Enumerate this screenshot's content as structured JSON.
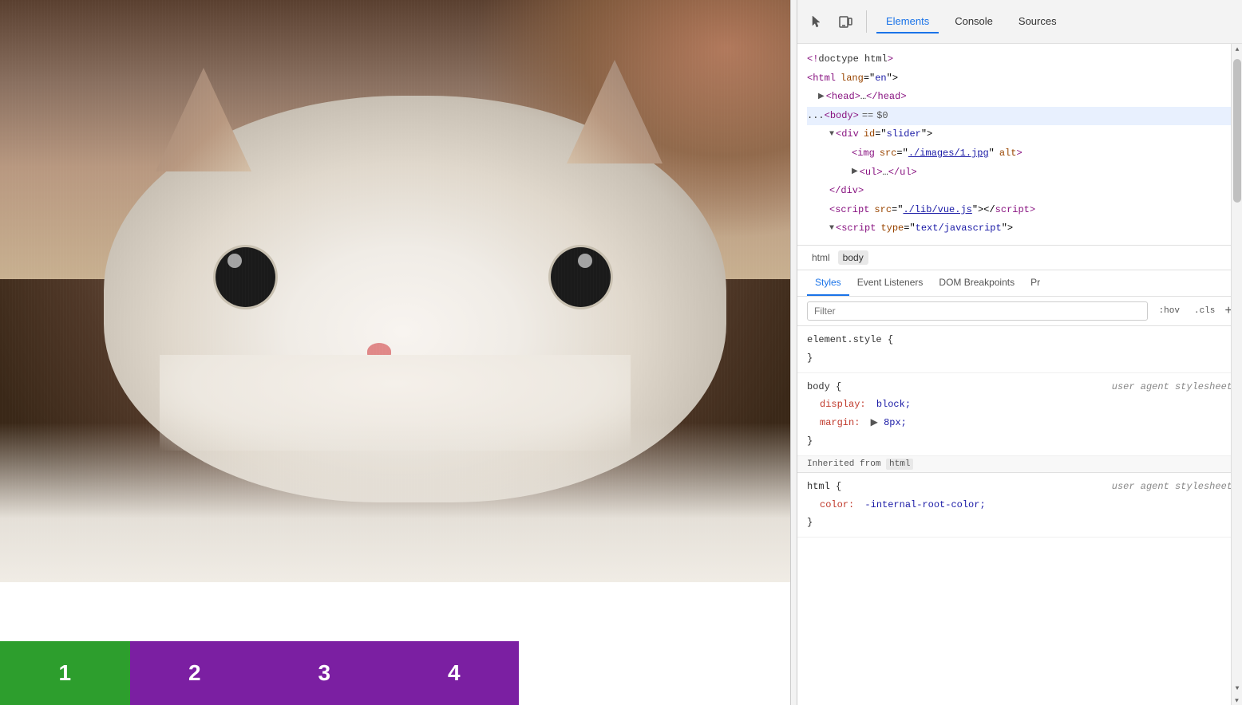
{
  "webpage": {
    "slider_nav": {
      "buttons": [
        {
          "label": "1",
          "color": "#2d9e2d"
        },
        {
          "label": "2",
          "color": "#7b1fa2"
        },
        {
          "label": "3",
          "color": "#7b1fa2"
        },
        {
          "label": "4",
          "color": "#7b1fa2"
        }
      ]
    }
  },
  "devtools": {
    "toolbar": {
      "tabs": [
        {
          "label": "Elements",
          "active": true
        },
        {
          "label": "Console",
          "active": false
        },
        {
          "label": "Sources",
          "active": false
        }
      ]
    },
    "elements_tree": {
      "lines": [
        {
          "indent": 0,
          "content": "doctype_html",
          "type": "doctype"
        },
        {
          "indent": 0,
          "content": "html_lang_en",
          "type": "open_tag"
        },
        {
          "indent": 1,
          "content": "head_collapsed",
          "type": "collapsed"
        },
        {
          "indent": 1,
          "content": "body_selected",
          "type": "selected"
        },
        {
          "indent": 2,
          "content": "div_slider",
          "type": "open_tag"
        },
        {
          "indent": 3,
          "content": "img_src",
          "type": "self_close"
        },
        {
          "indent": 3,
          "content": "ul_collapsed",
          "type": "collapsed"
        },
        {
          "indent": 2,
          "content": "div_close",
          "type": "close_tag"
        },
        {
          "indent": 2,
          "content": "script_vue",
          "type": "self_close"
        },
        {
          "indent": 2,
          "content": "script_type_js",
          "type": "open_tag"
        }
      ]
    },
    "breadcrumb": {
      "items": [
        "html",
        "body"
      ]
    },
    "styles_tabs": [
      "Styles",
      "Event Listeners",
      "DOM Breakpoints",
      "Pr"
    ],
    "filter": {
      "placeholder": "Filter",
      "hov_label": ":hov",
      "cls_label": ".cls"
    },
    "css_rules": [
      {
        "selector": "element.style {",
        "close": "}",
        "properties": []
      },
      {
        "selector": "body {",
        "source": "user agent stylesheet",
        "close": "}",
        "properties": [
          {
            "name": "display:",
            "value": "block;"
          },
          {
            "name": "margin:",
            "value": "▶ 8px;"
          }
        ]
      },
      {
        "inherited_from": "html",
        "selector": "html {",
        "source": "user agent stylesheet",
        "close": "}",
        "properties": [
          {
            "name": "color:",
            "value": "-internal-root-color;"
          }
        ]
      }
    ]
  }
}
